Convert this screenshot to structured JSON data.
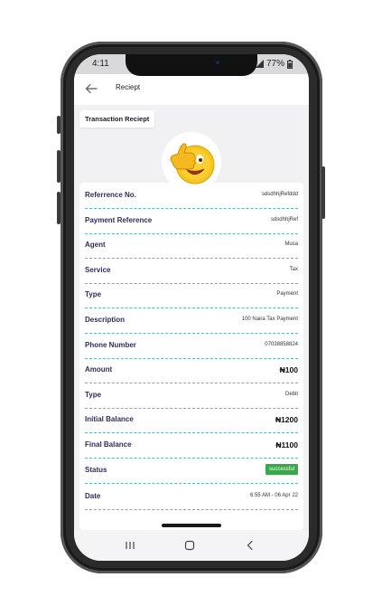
{
  "status_bar": {
    "time": "4:11",
    "battery": "77%"
  },
  "header": {
    "title": "Reciept"
  },
  "section_tab": {
    "label": "Transaction Reciept"
  },
  "rows": [
    {
      "label": "Referrence No.",
      "value": "sdsdhhjRefddd"
    },
    {
      "label": "Payment Reference",
      "value": "sdsdhhjRef"
    },
    {
      "label": "Agent",
      "value": "Musa"
    },
    {
      "label": "Service",
      "value": "Tax"
    },
    {
      "label": "Type",
      "value": "Payment"
    },
    {
      "label": "Description",
      "value": "100 Naira Tax Payment"
    },
    {
      "label": "Phone Number",
      "value": "07038858824"
    },
    {
      "label": "Amount",
      "value": "₦100"
    },
    {
      "label": "Type",
      "value": "Debit"
    },
    {
      "label": "Initial Balance",
      "value": "₦1200"
    },
    {
      "label": "Final Balance",
      "value": "₦1100"
    },
    {
      "label": "Status",
      "value": "successful"
    },
    {
      "label": "Date",
      "value": "6:55 AM - 06 Apr 22"
    }
  ],
  "colors": {
    "status_badge": "#3aa64a",
    "label_text": "#2f2d5c",
    "divider": "#5fb9b0"
  },
  "icons": [
    "back-arrow-icon",
    "thumbs-up-emoji-icon",
    "recents-icon",
    "home-icon",
    "back-nav-icon",
    "signal-icon",
    "battery-icon"
  ]
}
